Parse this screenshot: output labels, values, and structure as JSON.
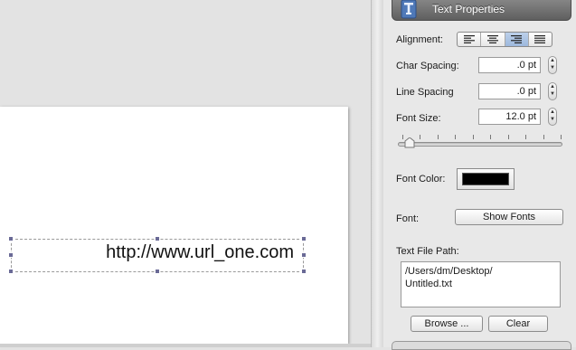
{
  "inspector": {
    "title": "Text Properties",
    "header_icon": "text-tool-icon",
    "alignment": {
      "label": "Alignment:",
      "options": [
        "align-left-icon",
        "align-center-icon",
        "align-right-icon",
        "align-justify-icon"
      ],
      "selected": "align-right-icon"
    },
    "char_spacing": {
      "label": "Char Spacing:",
      "value": ".0 pt"
    },
    "line_spacing": {
      "label": "Line Spacing",
      "value": ".0 pt"
    },
    "font_size": {
      "label": "Font Size:",
      "value": "12.0 pt"
    },
    "font_color": {
      "label": "Font Color:",
      "color": "#000000"
    },
    "font": {
      "label": "Font:",
      "button": "Show Fonts"
    },
    "text_file_path": {
      "label": "Text File Path:",
      "value": "/Users/dm/Desktop/\nUntitled.txt",
      "browse_button": "Browse ...",
      "clear_button": "Clear"
    }
  },
  "canvas": {
    "text_element": "http://www.url_one.com",
    "handle_color": "#6a6a96"
  }
}
